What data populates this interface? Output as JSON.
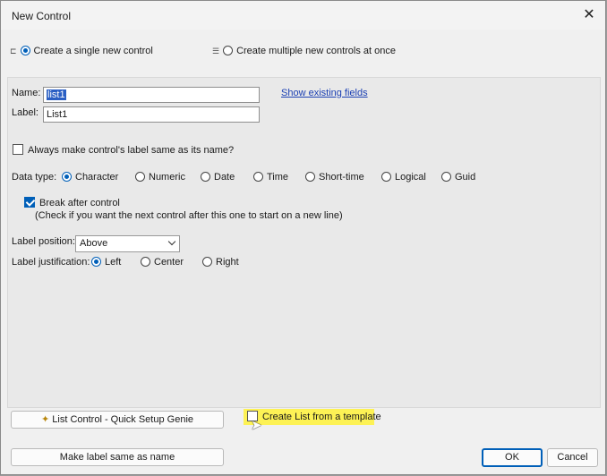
{
  "window": {
    "title": "New Control",
    "close_glyph": "✕"
  },
  "mode": {
    "single": {
      "label": "Create a single new control",
      "selected": true
    },
    "multiple": {
      "label": "Create multiple new controls at once",
      "selected": false
    }
  },
  "fields": {
    "name_label": "Name:",
    "name_value": "list1",
    "label_label": "Label:",
    "label_value": "List1",
    "show_existing": "Show existing fields"
  },
  "always_same": {
    "label": "Always make control's label same as its name?",
    "checked": false
  },
  "data_type": {
    "label": "Data type:",
    "options": [
      {
        "label": "Character",
        "selected": true
      },
      {
        "label": "Numeric",
        "selected": false
      },
      {
        "label": "Date",
        "selected": false
      },
      {
        "label": "Time",
        "selected": false
      },
      {
        "label": "Short-time",
        "selected": false
      },
      {
        "label": "Logical",
        "selected": false
      },
      {
        "label": "Guid",
        "selected": false
      }
    ]
  },
  "break_after": {
    "label": "Break after control",
    "hint": "(Check if you want the next control after this one to start on a new line)",
    "checked": true
  },
  "label_position": {
    "label": "Label position:",
    "value": "Above"
  },
  "label_justification": {
    "label": "Label justification:",
    "options": [
      {
        "label": "Left",
        "selected": true
      },
      {
        "label": "Center",
        "selected": false
      },
      {
        "label": "Right",
        "selected": false
      }
    ]
  },
  "bottom": {
    "genie_button": "List Control - Quick Setup Genie",
    "template_check": "Create List from a template",
    "make_label_button": "Make label same as name",
    "ok": "OK",
    "cancel": "Cancel"
  },
  "colors": {
    "accent": "#005fb8",
    "highlight": "#fff23a",
    "link": "#1a3fb3"
  }
}
